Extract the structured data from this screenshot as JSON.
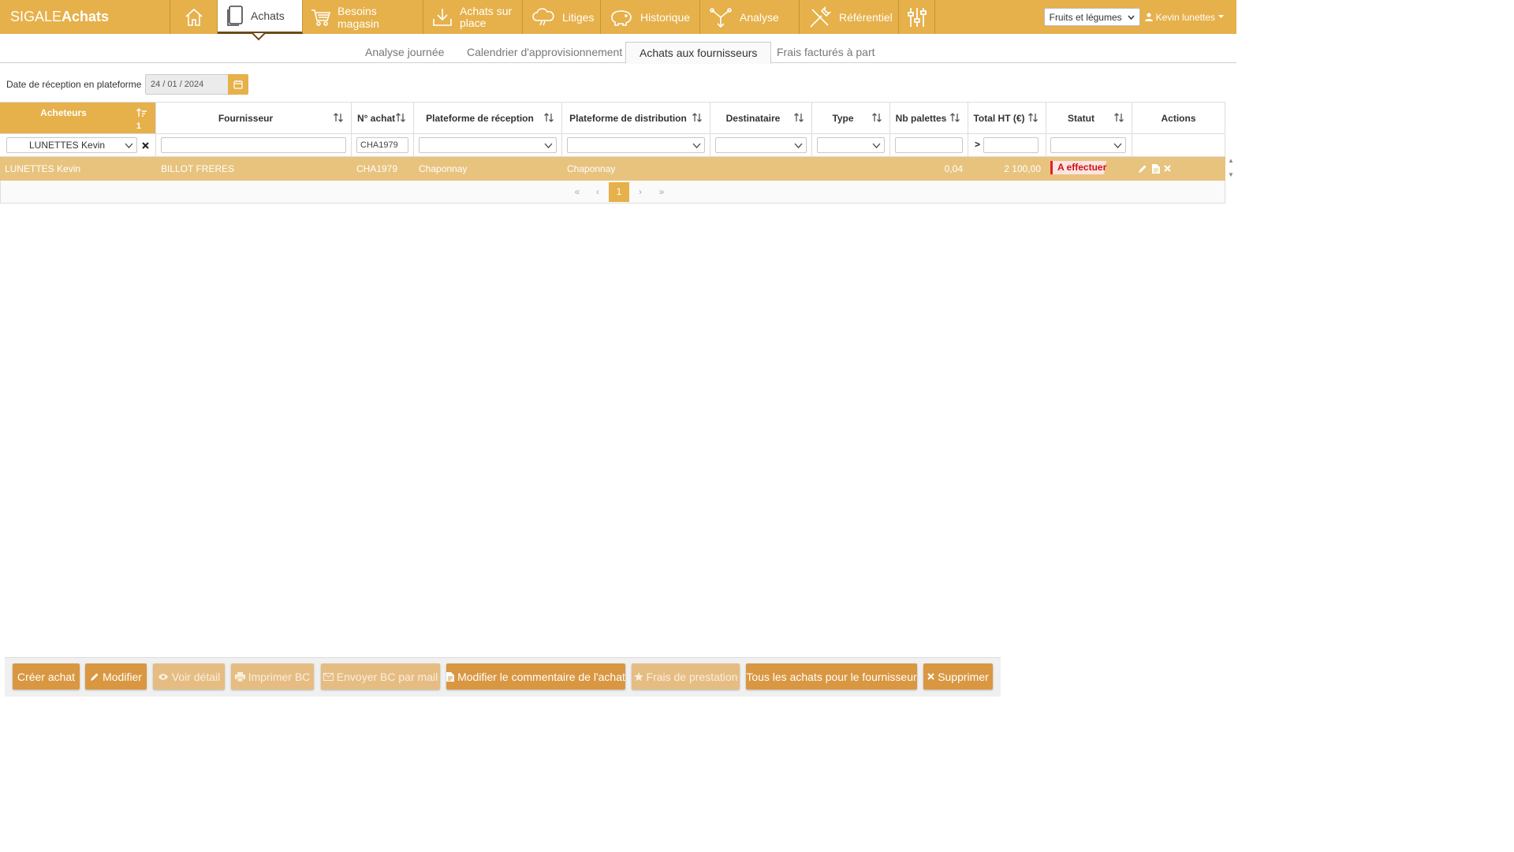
{
  "app": {
    "brand_light": "SIGALE",
    "brand_bold": "Achats"
  },
  "nav": {
    "items": [
      {
        "label": ""
      },
      {
        "label": "Achats"
      },
      {
        "label": "Besoins magasin"
      },
      {
        "label_line1": "Achats sur",
        "label_line2": "place"
      },
      {
        "label": "Litiges"
      },
      {
        "label": "Historique"
      },
      {
        "label": "Analyse"
      },
      {
        "label": "Référentiel"
      }
    ],
    "category_select": "Fruits et légumes",
    "user": "Kevin lunettes"
  },
  "subtabs": [
    "Analyse journée",
    "Calendrier d'approvisionnement",
    "Achats aux fournisseurs",
    "Frais facturés à part"
  ],
  "filter": {
    "date_label": "Date de réception en plateforme",
    "date_value": "24 / 01 / 2024"
  },
  "table": {
    "headers": [
      "Acheteurs",
      "Fournisseur",
      "N° achat",
      "Plateforme de réception",
      "Plateforme de distribution",
      "Destinataire",
      "Type",
      "Nb palettes",
      "Total HT (€)",
      "Statut",
      "Actions"
    ],
    "sort_index": "1",
    "filters": {
      "buyer": "LUNETTES Kevin",
      "purchase_no": "CHA1979",
      "total_operator": ">"
    },
    "rows": [
      {
        "buyer": "LUNETTES Kevin",
        "supplier": "BILLOT FRERES",
        "purchase_no": "CHA1979",
        "reception_platform": "Chaponnay",
        "distribution_platform": "Chaponnay",
        "recipient": "",
        "type": "",
        "pallets": "0,04",
        "total": "2 100,00",
        "status": "A effectuer"
      }
    ],
    "pagination": {
      "first": "«",
      "prev": "‹",
      "current": "1",
      "next": "›",
      "last": "»"
    }
  },
  "actions": {
    "create": "Créer achat",
    "modify": "Modifier",
    "view": "Voir détail",
    "print": "Imprimer BC",
    "mail": "Envoyer BC par mail",
    "comment": "Modifier le commentaire de l'achat",
    "fees": "Frais de prestation",
    "all_supplier": "Tous les achats pour le fournisseur",
    "delete": "Supprimer"
  },
  "colors": {
    "accent": "#e6b04a",
    "row_selected": "#e8c37e",
    "button": "#d99741",
    "status_red": "#e02020"
  }
}
